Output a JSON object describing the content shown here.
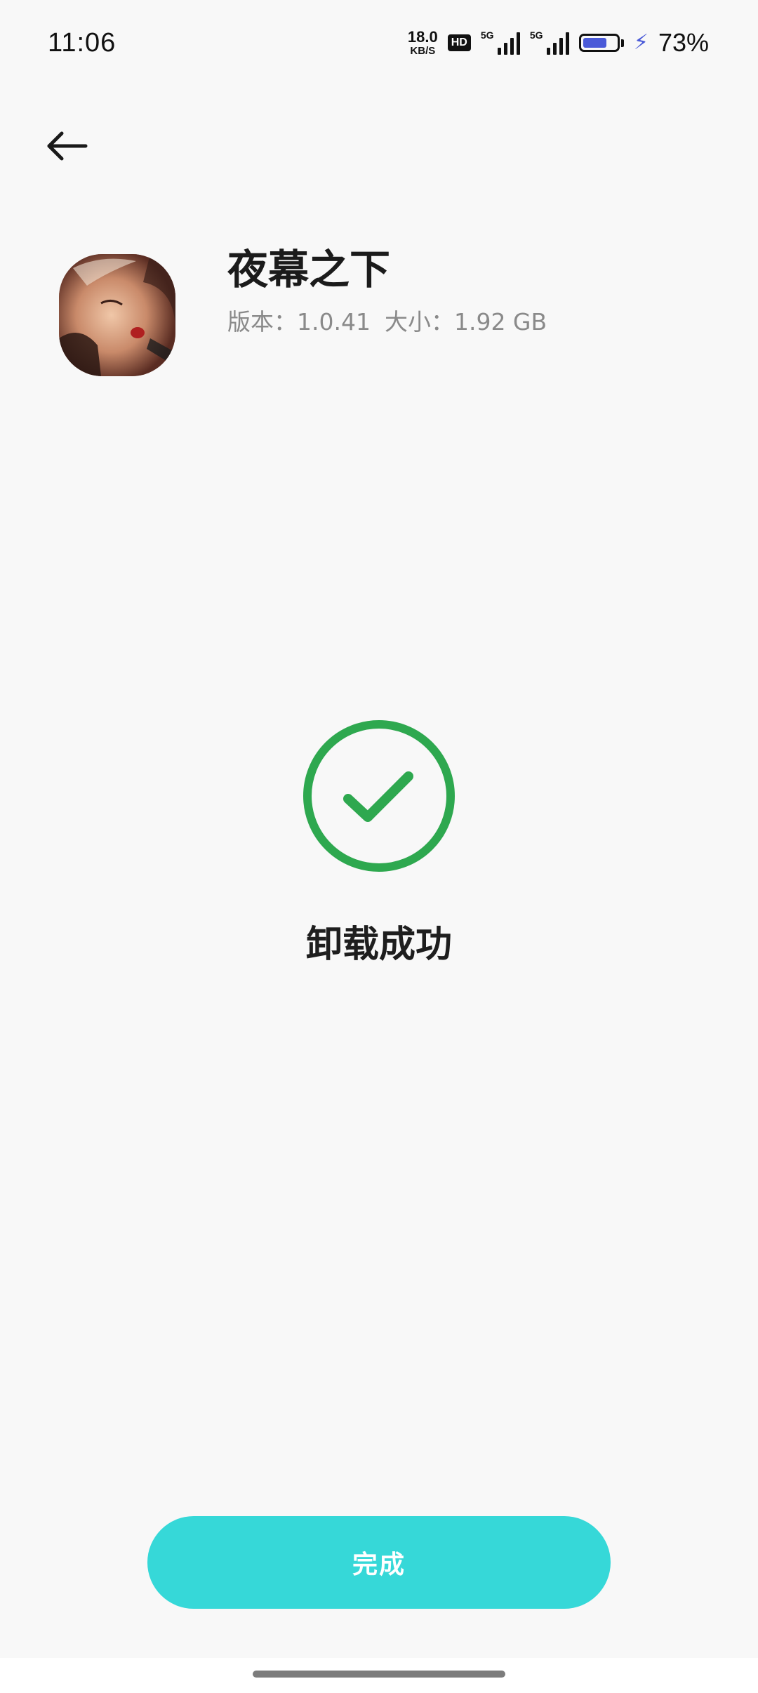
{
  "status_bar": {
    "time": "11:06",
    "net_speed_value": "18.0",
    "net_speed_unit": "KB/S",
    "hd_badge": "HD",
    "signal1_label": "5G",
    "signal2_label": "5G",
    "battery_level": 0.73,
    "battery_color": "#4a5ad8",
    "battery_text": "73%"
  },
  "app": {
    "name": "夜幕之下",
    "version_label": "版本：1.0.41",
    "size_label": "大小：1.92 GB"
  },
  "result": {
    "message": "卸载成功",
    "icon": "check-circle-icon",
    "color": "#2ea84f"
  },
  "actions": {
    "done_label": "完成",
    "done_color": "#36d8d8"
  }
}
